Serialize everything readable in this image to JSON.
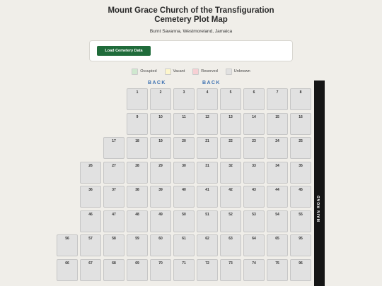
{
  "header": {
    "title_line1": "Mount Grace Church of the Transfiguration",
    "title_line2": "Cemetery Plot Map",
    "subtitle": "Burnt Savanna, Westmoreland, Jamaica"
  },
  "controls": {
    "load_label": "Load Cemetery Data"
  },
  "legend": [
    {
      "label": "Occupied",
      "color": "#cfe8cf"
    },
    {
      "label": "Vacant",
      "color": "#fdf6cc"
    },
    {
      "label": "Reserved",
      "color": "#f7d0d4"
    },
    {
      "label": "Unknown",
      "color": "#e1e1e1"
    }
  ],
  "back_labels": [
    "BACK",
    "BACK"
  ],
  "road_label": "MAIN ROAD",
  "plot_rows": [
    [
      "8",
      "7",
      "6",
      "5",
      "4",
      "3",
      "2",
      "1"
    ],
    [
      "16",
      "15",
      "14",
      "13",
      "12",
      "11",
      "10",
      "9"
    ],
    [
      "25",
      "24",
      "23",
      "22",
      "21",
      "20",
      "19",
      "18",
      "17"
    ],
    [
      "35",
      "34",
      "33",
      "32",
      "31",
      "30",
      "29",
      "28",
      "27",
      "26"
    ],
    [
      "45",
      "44",
      "43",
      "42",
      "41",
      "40",
      "39",
      "38",
      "37",
      "36"
    ],
    [
      "55",
      "54",
      "53",
      "52",
      "51",
      "50",
      "49",
      "48",
      "47",
      "46"
    ],
    [
      "95",
      "65",
      "64",
      "63",
      "62",
      "61",
      "60",
      "59",
      "58",
      "57",
      "56"
    ],
    [
      "96",
      "75",
      "74",
      "73",
      "72",
      "71",
      "70",
      "69",
      "68",
      "67",
      "66"
    ]
  ]
}
